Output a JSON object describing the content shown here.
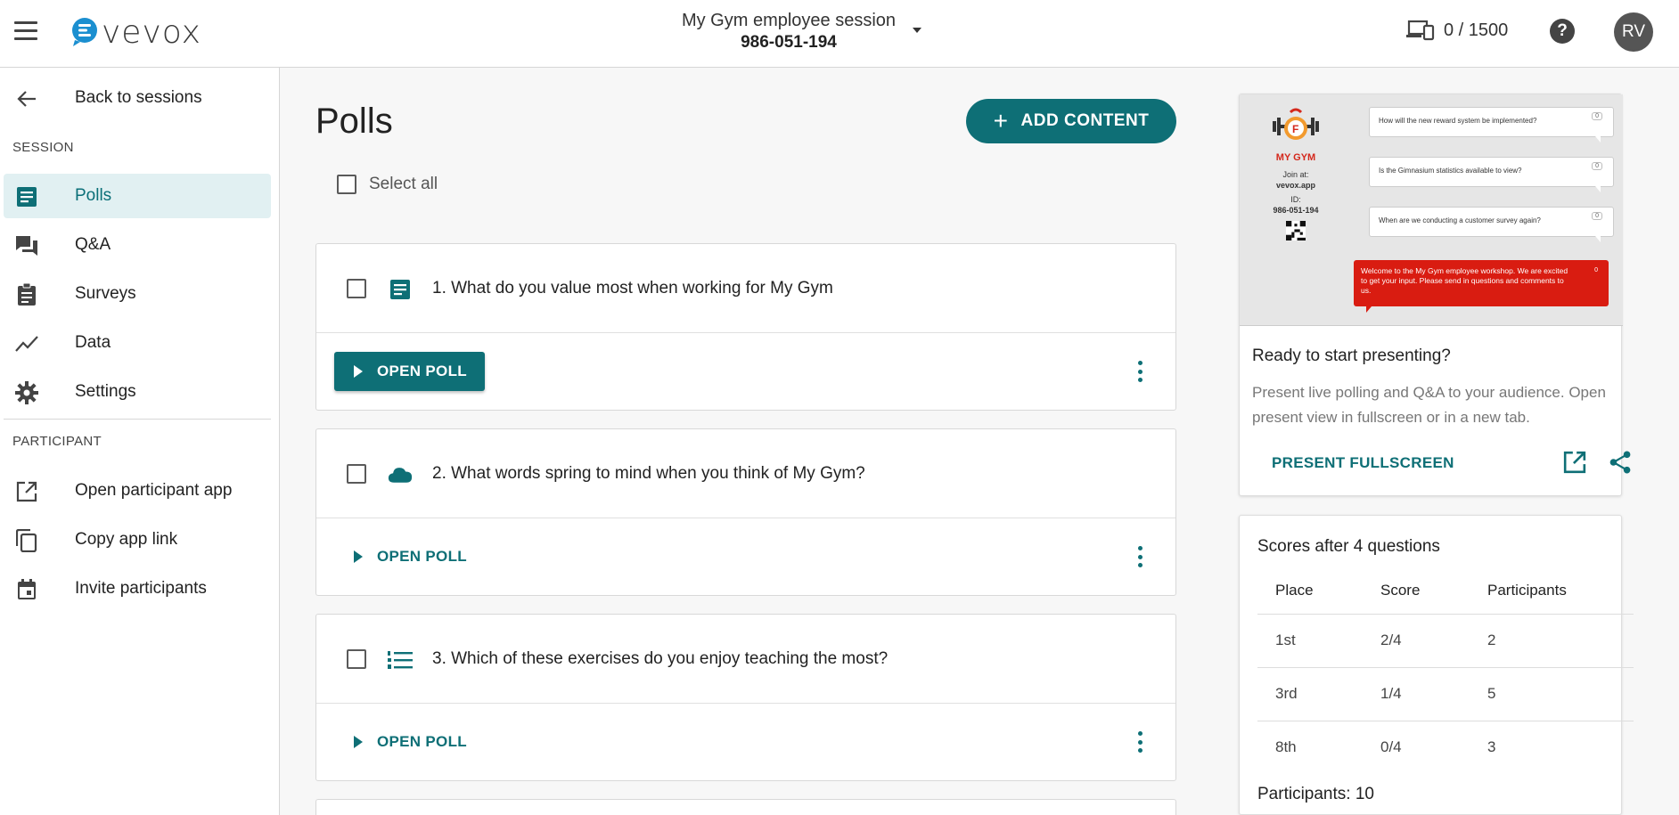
{
  "topbar": {
    "logo_text": "vevox",
    "session_name": "My Gym employee session",
    "session_id": "986-051-194",
    "device_count": "0 / 1500",
    "help_label": "?",
    "avatar_initials": "RV"
  },
  "sidebar": {
    "back_label": "Back to sessions",
    "session_header": "SESSION",
    "session_items": [
      {
        "label": "Polls",
        "icon": "poll-icon",
        "active": true
      },
      {
        "label": "Q&A",
        "icon": "qa-icon"
      },
      {
        "label": "Surveys",
        "icon": "survey-icon"
      },
      {
        "label": "Data",
        "icon": "data-icon"
      },
      {
        "label": "Settings",
        "icon": "gear-icon"
      }
    ],
    "participant_header": "PARTICIPANT",
    "participant_items": [
      {
        "label": "Open participant app",
        "icon": "open-external-icon"
      },
      {
        "label": "Copy app link",
        "icon": "copy-icon"
      },
      {
        "label": "Invite participants",
        "icon": "calendar-icon"
      }
    ]
  },
  "main": {
    "title": "Polls",
    "add_content_label": "ADD CONTENT",
    "select_all_label": "Select all",
    "polls": [
      {
        "question": "1. What do you value most when working for My Gym",
        "type_icon": "multiple-choice-icon",
        "open_label": "OPEN POLL",
        "style": "filled"
      },
      {
        "question": "2. What words spring to mind when you think of My Gym?",
        "type_icon": "word-cloud-icon",
        "open_label": "OPEN POLL",
        "style": "text"
      },
      {
        "question": "3. Which of these exercises do you enjoy teaching the most?",
        "type_icon": "ranked-list-icon",
        "open_label": "OPEN POLL",
        "style": "text"
      }
    ]
  },
  "present": {
    "preview": {
      "brand_name": "MY GYM",
      "join_at_label": "Join at:",
      "join_url": "vevox.app",
      "id_label": "ID:",
      "id_value": "986-051-194",
      "bubbles": [
        "How will the new reward system be implemented?",
        "Is the Gimnasium statistics available to view?",
        "When are we conducting a customer survey again?"
      ],
      "bubble_likes": "0",
      "welcome_message": "Welcome to the My Gym employee workshop. We are excited to get your input. Please send in questions and comments to us.",
      "welcome_likes": "0"
    },
    "title": "Ready to start presenting?",
    "description": "Present live polling and Q&A to your audience. Open present view in fullscreen or in a new tab.",
    "fullscreen_label": "PRESENT FULLSCREEN"
  },
  "scores": {
    "title": "Scores after 4 questions",
    "columns": [
      "Place",
      "Score",
      "Participants"
    ],
    "rows": [
      [
        "1st",
        "2/4",
        "2"
      ],
      [
        "3rd",
        "1/4",
        "5"
      ],
      [
        "8th",
        "0/4",
        "3"
      ]
    ],
    "participants_total": "Participants: 10"
  },
  "colors": {
    "accent": "#0e6f76",
    "active_bg": "#e1f0f2",
    "brand_red": "#d91c11"
  }
}
